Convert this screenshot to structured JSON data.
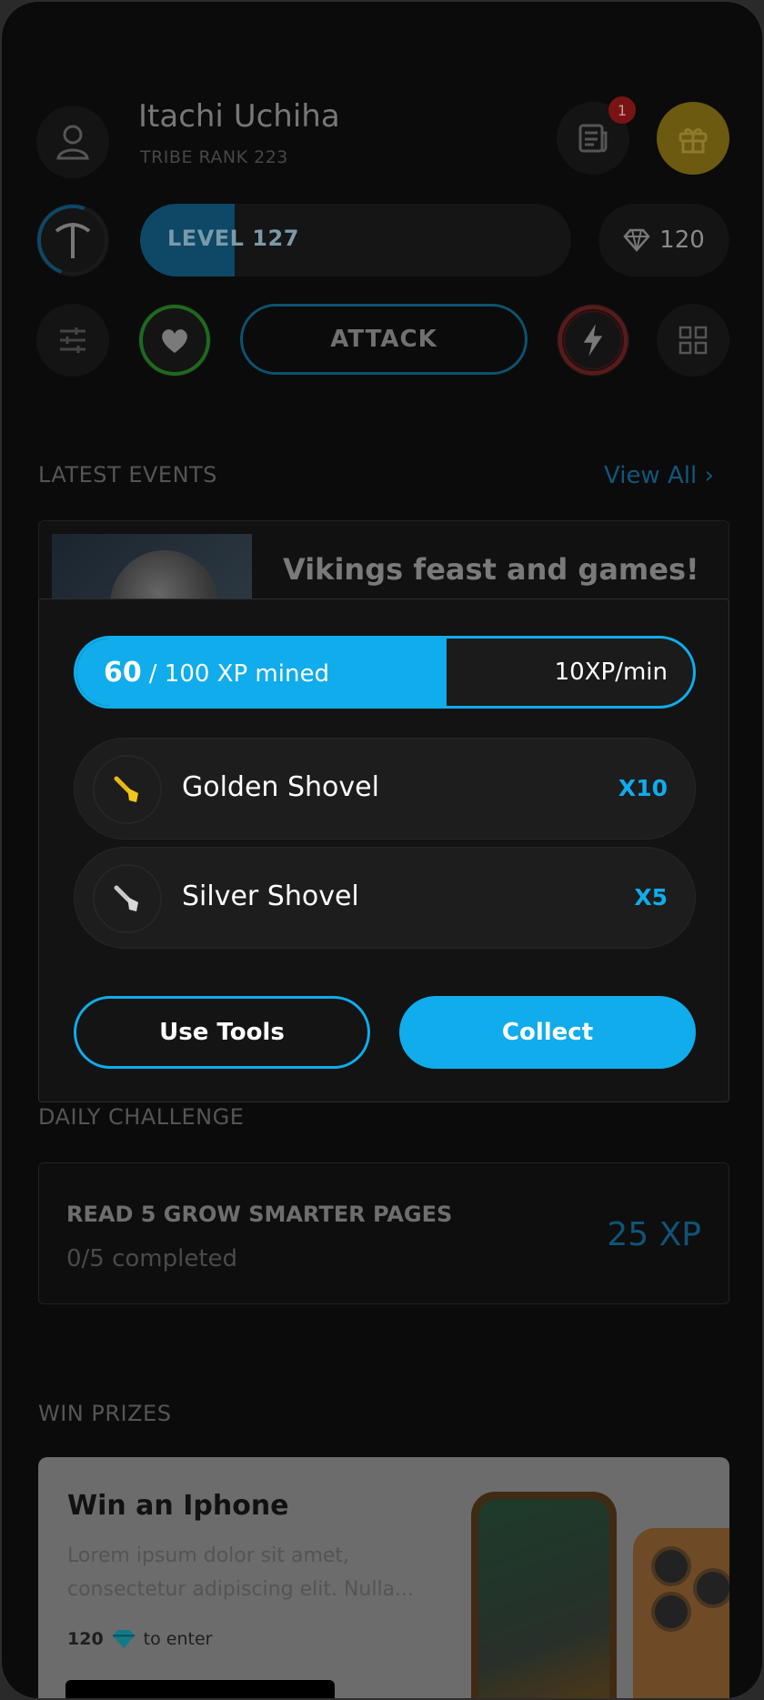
{
  "profile": {
    "name": "Itachi Uchiha",
    "tribe_rank": "TRIBE RANK 223",
    "notifications_count": "1"
  },
  "level": {
    "label": "LEVEL 127",
    "progress": 0.22
  },
  "gems": {
    "count": "120"
  },
  "actions": {
    "attack_label": "ATTACK"
  },
  "events": {
    "section_title": "LATEST EVENTS",
    "view_all": "View All",
    "items": [
      {
        "title": "Vikings feast and games!"
      }
    ]
  },
  "mining_modal": {
    "xp_current": "60",
    "xp_total_text": "/ 100 XP mined",
    "xp_progress": 0.6,
    "rate": "10XP/min",
    "tools": [
      {
        "name": "Golden Shovel",
        "count": "X10",
        "icon": "golden-shovel-icon"
      },
      {
        "name": "Silver Shovel",
        "count": "X5",
        "icon": "silver-shovel-icon"
      }
    ],
    "use_tools_label": "Use Tools",
    "collect_label": "Collect"
  },
  "daily_challenge": {
    "section_title": "DAILY CHALLENGE",
    "title": "READ 5 GROW SMARTER PAGES",
    "progress_text": "0/5 completed",
    "reward": "25 XP"
  },
  "prizes": {
    "section_title": "WIN PRIZES",
    "items": [
      {
        "title": "Win an Iphone",
        "description": "Lorem ipsum dolor sit amet, consectetur adipiscing elit. Nulla...",
        "cost": "120",
        "cost_suffix": "to enter"
      }
    ]
  },
  "colors": {
    "accent": "#10acec",
    "background": "#0b0b0b",
    "gift": "#f2c619",
    "alert": "#e03131",
    "health": "#2fb12f"
  }
}
